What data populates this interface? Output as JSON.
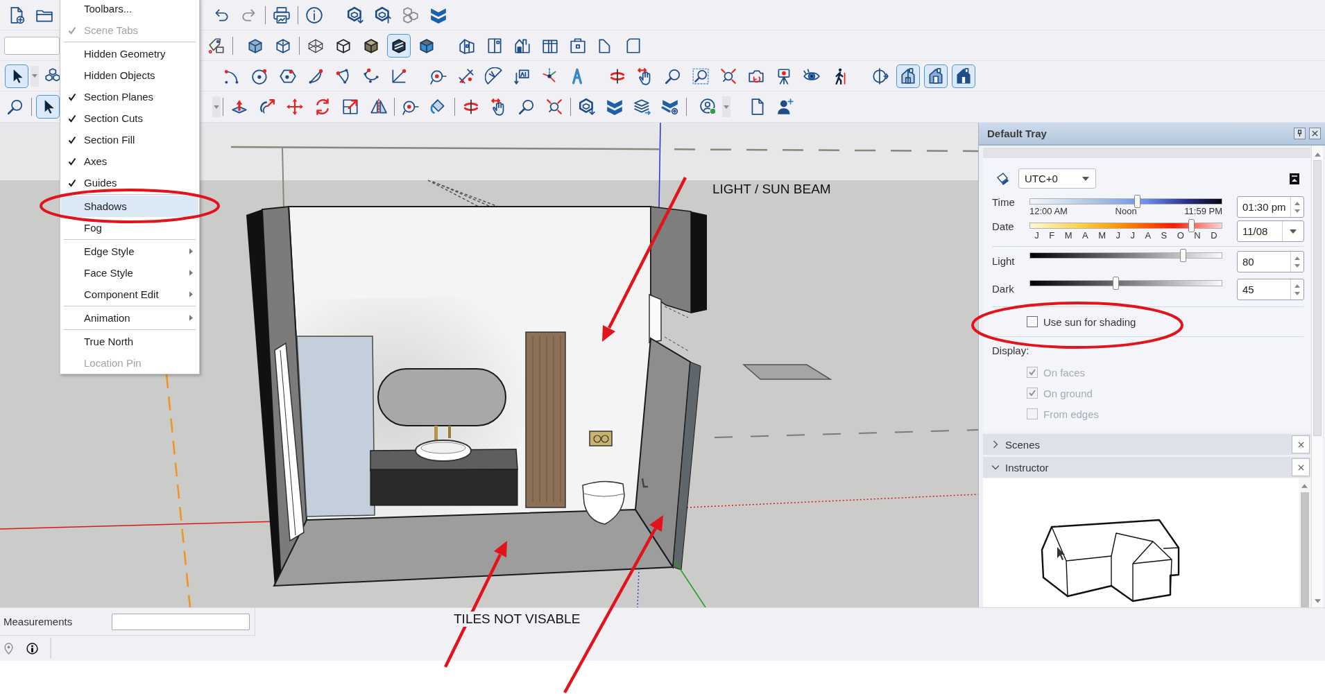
{
  "toolbars": [
    {
      "buttons": [
        {
          "pressed": false
        },
        {
          "pressed": false
        },
        {
          "pressed": false
        },
        {
          "pressed": false
        },
        {
          "pressed": false
        },
        {
          "pressed": false
        },
        {
          "pressed": false
        },
        {
          "pressed": false
        },
        {
          "pressed": false
        },
        {
          "pressed": false
        }
      ]
    },
    {
      "buttons": [
        {
          "pressed": false
        },
        {
          "pressed": false
        },
        {
          "pressed": false
        },
        {
          "pressed": false
        },
        {
          "pressed": false
        },
        {
          "pressed": false
        },
        {
          "pressed": true
        },
        {
          "pressed": false
        },
        {
          "pressed": false
        },
        {
          "pressed": false
        },
        {
          "pressed": false
        },
        {
          "pressed": false
        },
        {
          "pressed": false
        },
        {
          "pressed": false
        },
        {
          "pressed": false
        }
      ]
    },
    {
      "buttons": [
        {
          "pressed": true
        },
        {
          "pressed": false
        },
        {
          "pressed": false
        },
        {
          "pressed": false
        },
        {
          "pressed": false
        },
        {
          "pressed": false
        },
        {
          "pressed": false
        },
        {
          "pressed": false
        },
        {
          "pressed": false
        },
        {
          "pressed": false
        },
        {
          "pressed": false
        },
        {
          "pressed": false
        },
        {
          "pressed": false
        },
        {
          "pressed": false
        },
        {
          "pressed": false
        },
        {
          "pressed": false
        },
        {
          "pressed": false
        },
        {
          "pressed": false
        },
        {
          "pressed": false
        },
        {
          "pressed": false
        },
        {
          "pressed": false
        },
        {
          "pressed": false
        },
        {
          "pressed": false
        },
        {
          "pressed": false
        },
        {
          "pressed": false
        },
        {
          "pressed": true
        },
        {
          "pressed": true
        },
        {
          "pressed": true
        }
      ]
    },
    {
      "buttons": [
        {
          "pressed": false
        },
        {
          "pressed": true
        },
        {
          "pressed": false
        },
        {
          "pressed": false
        },
        {
          "pressed": false
        },
        {
          "pressed": false
        },
        {
          "pressed": false
        },
        {
          "pressed": false
        },
        {
          "pressed": false
        },
        {
          "pressed": false
        },
        {
          "pressed": false
        },
        {
          "pressed": false
        },
        {
          "pressed": false
        },
        {
          "pressed": false
        },
        {
          "pressed": false
        },
        {
          "pressed": false
        },
        {
          "pressed": false
        },
        {
          "pressed": false
        },
        {
          "pressed": false
        },
        {
          "pressed": false
        },
        {
          "pressed": false
        }
      ]
    }
  ],
  "view_menu": {
    "items": [
      {
        "kind": "item",
        "label": "Toolbars...",
        "checked": false,
        "disabled": false,
        "selected": false,
        "submenu": false
      },
      {
        "kind": "item",
        "label": "Scene Tabs",
        "checked": true,
        "disabled": true,
        "selected": false,
        "submenu": false
      },
      {
        "kind": "separator"
      },
      {
        "kind": "item",
        "label": "Hidden Geometry",
        "checked": false,
        "disabled": false,
        "selected": false,
        "submenu": false
      },
      {
        "kind": "item",
        "label": "Hidden Objects",
        "checked": false,
        "disabled": false,
        "selected": false,
        "submenu": false
      },
      {
        "kind": "item",
        "label": "Section Planes",
        "checked": true,
        "disabled": false,
        "selected": false,
        "submenu": false
      },
      {
        "kind": "item",
        "label": "Section Cuts",
        "checked": true,
        "disabled": false,
        "selected": false,
        "submenu": false
      },
      {
        "kind": "item",
        "label": "Section Fill",
        "checked": true,
        "disabled": false,
        "selected": false,
        "submenu": false
      },
      {
        "kind": "item",
        "label": "Axes",
        "checked": true,
        "disabled": false,
        "selected": false,
        "submenu": false
      },
      {
        "kind": "item",
        "label": "Guides",
        "checked": true,
        "disabled": false,
        "selected": false,
        "submenu": false
      },
      {
        "kind": "separator"
      },
      {
        "kind": "item",
        "label": "Shadows",
        "checked": false,
        "disabled": false,
        "selected": true,
        "submenu": false
      },
      {
        "kind": "item",
        "label": "Fog",
        "checked": false,
        "disabled": false,
        "selected": false,
        "submenu": false
      },
      {
        "kind": "separator"
      },
      {
        "kind": "item",
        "label": "Edge Style",
        "checked": false,
        "disabled": false,
        "selected": false,
        "submenu": true
      },
      {
        "kind": "item",
        "label": "Face Style",
        "checked": false,
        "disabled": false,
        "selected": false,
        "submenu": true
      },
      {
        "kind": "item",
        "label": "Component Edit",
        "checked": false,
        "disabled": false,
        "selected": false,
        "submenu": true
      },
      {
        "kind": "separator"
      },
      {
        "kind": "item",
        "label": "Animation",
        "checked": false,
        "disabled": false,
        "selected": false,
        "submenu": true
      },
      {
        "kind": "separator"
      },
      {
        "kind": "item",
        "label": "True North",
        "checked": false,
        "disabled": false,
        "selected": false,
        "submenu": false
      },
      {
        "kind": "item",
        "label": "Location Pin",
        "checked": false,
        "disabled": true,
        "selected": false,
        "submenu": false
      }
    ]
  },
  "annotations": [
    {
      "text": "LIGHT / SUN BEAM"
    },
    {
      "text": "TILES NOT VISABLE"
    }
  ],
  "tray": {
    "title": "Default Tray",
    "shadows": {
      "timezone": "UTC+0",
      "sun_sliders": [
        {
          "kind": "time",
          "label": "Time",
          "level": 0.56,
          "ticks": [
            "12:00 AM",
            "Noon",
            "11:59 PM"
          ],
          "value": "01:30 pm"
        },
        {
          "kind": "date",
          "label": "Date",
          "level": 0.84,
          "ticks": [
            "J",
            "F",
            "M",
            "A",
            "M",
            "J",
            "J",
            "A",
            "S",
            "O",
            "N",
            "D"
          ],
          "value": "11/08"
        }
      ],
      "light_sliders": [
        {
          "kind": "gray",
          "label": "Light",
          "level": 0.8,
          "value": "80"
        },
        {
          "kind": "gray",
          "label": "Dark",
          "level": 0.45,
          "value": "45"
        }
      ],
      "use_sun": {
        "label": "Use sun for shading",
        "checked": false
      },
      "display_label": "Display:",
      "display": [
        {
          "label": "On faces",
          "checked": true,
          "disabled": true
        },
        {
          "label": "On ground",
          "checked": true,
          "disabled": true
        },
        {
          "label": "From edges",
          "checked": false,
          "disabled": true
        }
      ]
    },
    "panels": [
      {
        "title": "Scenes",
        "expanded": false
      },
      {
        "title": "Instructor",
        "expanded": true
      }
    ]
  },
  "measurements": {
    "label": "Measurements"
  }
}
